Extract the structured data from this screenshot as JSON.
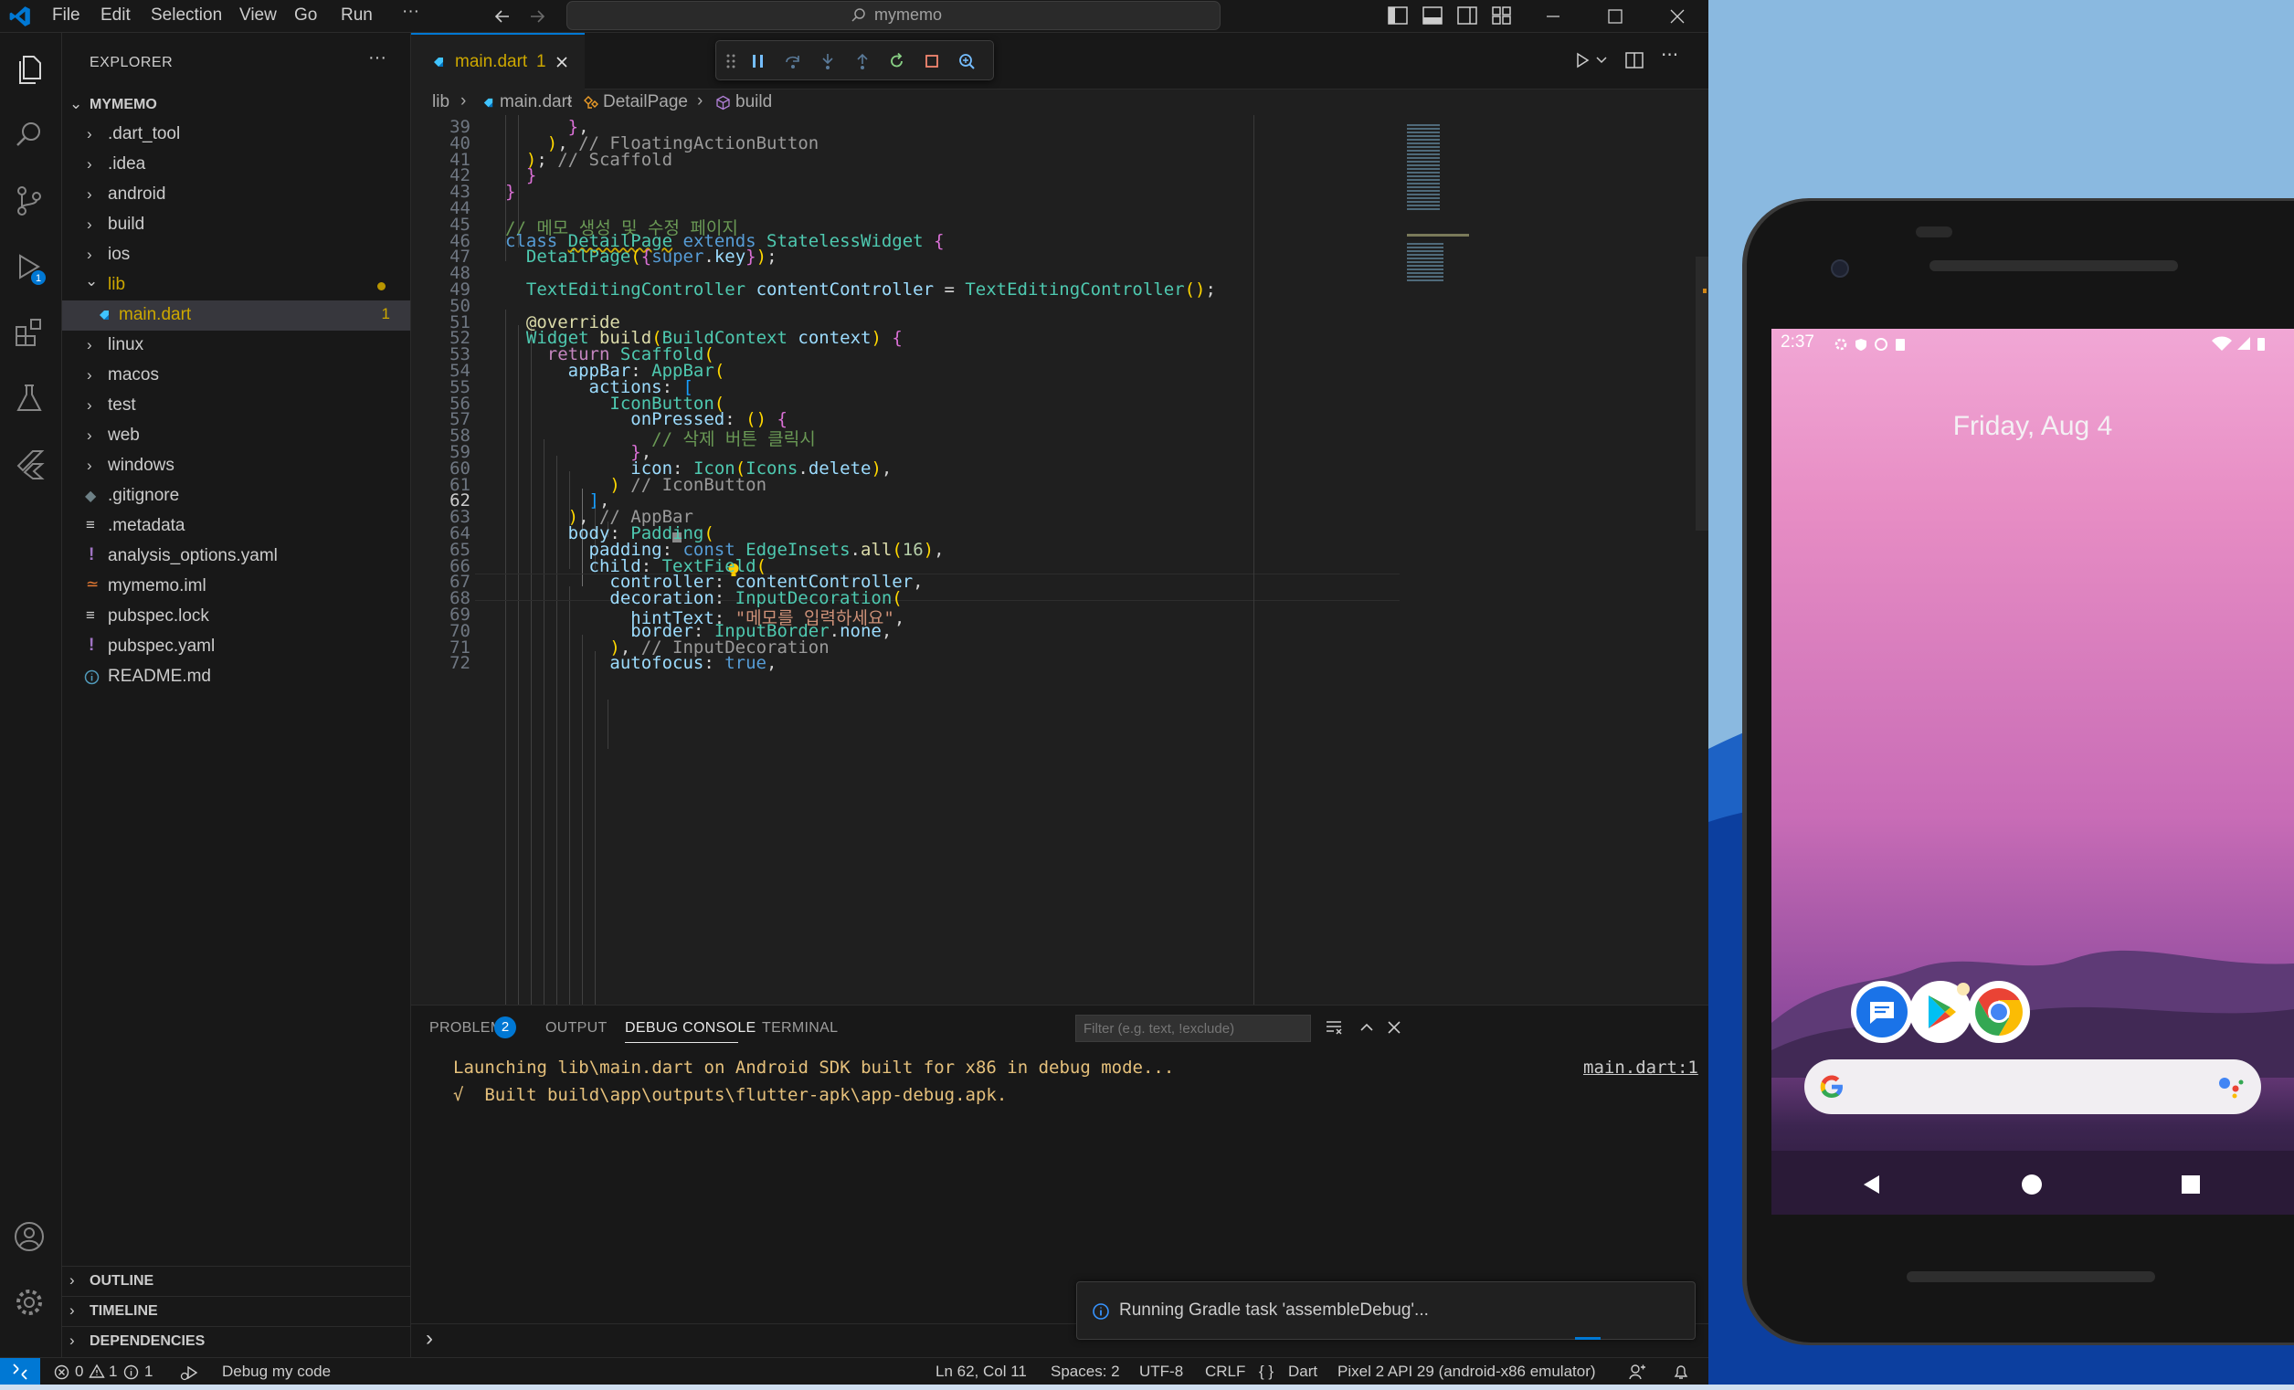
{
  "titlebar": {
    "menu": [
      "File",
      "Edit",
      "Selection",
      "View",
      "Go",
      "Run",
      "···"
    ],
    "search_text": "mymemo"
  },
  "explorer": {
    "title": "EXPLORER",
    "more": "···",
    "root": "MYMEMO",
    "items": [
      {
        "label": ".dart_tool",
        "type": "folder"
      },
      {
        "label": ".idea",
        "type": "folder"
      },
      {
        "label": "android",
        "type": "folder"
      },
      {
        "label": "build",
        "type": "folder"
      },
      {
        "label": "ios",
        "type": "folder"
      },
      {
        "label": "lib",
        "type": "folder-open"
      },
      {
        "label": "main.dart",
        "type": "file",
        "badge": "1"
      },
      {
        "label": "linux",
        "type": "folder"
      },
      {
        "label": "macos",
        "type": "folder"
      },
      {
        "label": "test",
        "type": "folder"
      },
      {
        "label": "web",
        "type": "folder"
      },
      {
        "label": "windows",
        "type": "folder"
      },
      {
        "label": ".gitignore",
        "type": "file"
      },
      {
        "label": ".metadata",
        "type": "file"
      },
      {
        "label": "analysis_options.yaml",
        "type": "file"
      },
      {
        "label": "mymemo.iml",
        "type": "file"
      },
      {
        "label": "pubspec.lock",
        "type": "file"
      },
      {
        "label": "pubspec.yaml",
        "type": "file"
      },
      {
        "label": "README.md",
        "type": "file"
      }
    ],
    "sections": [
      "OUTLINE",
      "TIMELINE",
      "DEPENDENCIES"
    ]
  },
  "editor": {
    "tab_label": "main.dart",
    "tab_badge": "1",
    "breadcrumb": [
      "lib",
      "main.dart",
      "DetailPage",
      "build"
    ],
    "current_line": 62,
    "lines": [
      {
        "n": 39,
        "code": "      },"
      },
      {
        "n": 40,
        "code": "    ), // FloatingActionButton"
      },
      {
        "n": 41,
        "code": "  ); // Scaffold"
      },
      {
        "n": 42,
        "code": "  }"
      },
      {
        "n": 43,
        "code": "}"
      },
      {
        "n": 44,
        "code": ""
      },
      {
        "n": 45,
        "code": "// 메모 생성 및 수정 페이지"
      },
      {
        "n": 46,
        "code": "class DetailPage extends StatelessWidget {"
      },
      {
        "n": 47,
        "code": "  DetailPage({super.key});"
      },
      {
        "n": 48,
        "code": ""
      },
      {
        "n": 49,
        "code": "  TextEditingController contentController = TextEditingController();"
      },
      {
        "n": 50,
        "code": ""
      },
      {
        "n": 51,
        "code": "  @override"
      },
      {
        "n": 52,
        "code": "  Widget build(BuildContext context) {"
      },
      {
        "n": 53,
        "code": "    return Scaffold("
      },
      {
        "n": 54,
        "code": "      appBar: AppBar("
      },
      {
        "n": 55,
        "code": "        actions: ["
      },
      {
        "n": 56,
        "code": "          IconButton("
      },
      {
        "n": 57,
        "code": "            onPressed: () {"
      },
      {
        "n": 58,
        "code": "              // 삭제 버튼 클릭시"
      },
      {
        "n": 59,
        "code": "            },"
      },
      {
        "n": 60,
        "code": "            icon: Icon(Icons.delete),"
      },
      {
        "n": 61,
        "code": "          ) // IconButton"
      },
      {
        "n": 62,
        "code": "        ],"
      },
      {
        "n": 63,
        "code": "      ), // AppBar"
      },
      {
        "n": 64,
        "code": "      body: Padding("
      },
      {
        "n": 65,
        "code": "        padding: const EdgeInsets.all(16),"
      },
      {
        "n": 66,
        "code": "        child: TextField("
      },
      {
        "n": 67,
        "code": "          controller: contentController,"
      },
      {
        "n": 68,
        "code": "          decoration: InputDecoration("
      },
      {
        "n": 69,
        "code": "            hintText: \"메모를 입력하세요\","
      },
      {
        "n": 70,
        "code": "            border: InputBorder.none,"
      },
      {
        "n": 71,
        "code": "          ), // InputDecoration"
      },
      {
        "n": 72,
        "code": "          autofocus: true,"
      }
    ]
  },
  "panel": {
    "tabs": [
      "PROBLEMS",
      "OUTPUT",
      "DEBUG CONSOLE",
      "TERMINAL"
    ],
    "problems_count": "2",
    "active_tab": "DEBUG CONSOLE",
    "filter_placeholder": "Filter (e.g. text, !exclude)",
    "console": [
      "Launching lib\\main.dart on Android SDK built for x86 in debug mode...",
      "√  Built build\\app\\outputs\\flutter-apk\\app-debug.apk."
    ],
    "source_link": "main.dart:1",
    "prompt": "›",
    "toast": "Running Gradle task 'assembleDebug'..."
  },
  "statusbar": {
    "errors": "0",
    "warnings": "1",
    "info": "1",
    "debug_label": "Debug my code",
    "position": "Ln 62, Col 11",
    "spaces": "Spaces: 2",
    "encoding": "UTF-8",
    "eol": "CRLF",
    "language": "Dart",
    "language_icon": "{ }",
    "device": "Pixel 2 API 29 (android-x86 emulator)"
  },
  "phone": {
    "time": "2:37",
    "date": "Friday, Aug 4"
  },
  "colors": {
    "accent": "#0078d4",
    "badge": "#cca700",
    "console_text": "#e5c07b"
  }
}
